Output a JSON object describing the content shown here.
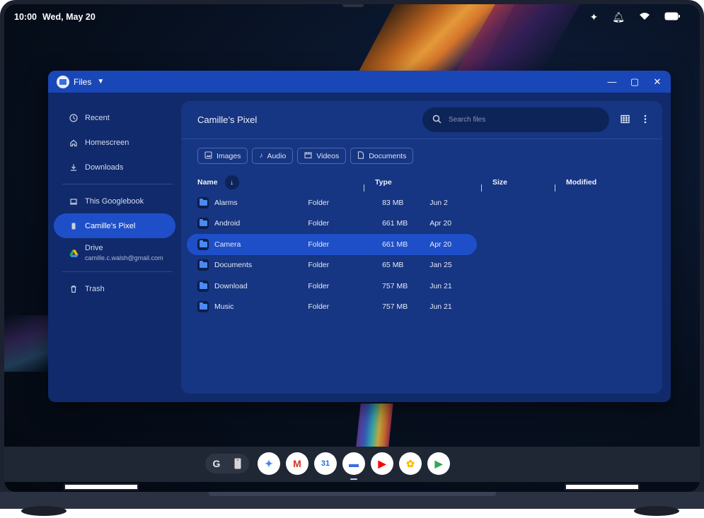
{
  "status": {
    "time": "10:00",
    "date": "Wed, May 20"
  },
  "window": {
    "title": "Files"
  },
  "sidebar": {
    "items": [
      {
        "label": "Recent",
        "icon": "clock-icon"
      },
      {
        "label": "Homescreen",
        "icon": "home-icon"
      },
      {
        "label": "Downloads",
        "icon": "download-icon"
      },
      {
        "label": "This Googlebook",
        "icon": "laptop-icon"
      },
      {
        "label": "Camille’s Pixel",
        "icon": "phone-icon",
        "active": true
      },
      {
        "label": "Trash",
        "icon": "trash-icon"
      }
    ],
    "drive": {
      "label": "Drive",
      "account": "camille.c.walsh@gmail.com"
    }
  },
  "main": {
    "title": "Camille’s Pixel",
    "search_placeholder": "Search files",
    "chips": [
      "Images",
      "Audio",
      "Videos",
      "Documents"
    ],
    "columns": {
      "name": "Name",
      "type": "Type",
      "size": "Size",
      "modified": "Modified"
    },
    "rows": [
      {
        "name": "Alarms",
        "type": "Folder",
        "size": "83 MB",
        "modified": "Jun 2"
      },
      {
        "name": "Android",
        "type": "Folder",
        "size": "661 MB",
        "modified": "Apr 20"
      },
      {
        "name": "Camera",
        "type": "Folder",
        "size": "661 MB",
        "modified": "Apr 20",
        "selected": true
      },
      {
        "name": "Documents",
        "type": "Folder",
        "size": "65 MB",
        "modified": "Jan 25"
      },
      {
        "name": "Download",
        "type": "Folder",
        "size": "757 MB",
        "modified": "Jun 21"
      },
      {
        "name": "Music",
        "type": "Folder",
        "size": "757 MB",
        "modified": "Jun 21"
      }
    ]
  },
  "shelf": {
    "pill": [
      "G"
    ],
    "apps": [
      {
        "name": "gemini-app",
        "glyph": "✦",
        "color": "#4285f4"
      },
      {
        "name": "gmail-app",
        "glyph": "M",
        "color": "#d93025"
      },
      {
        "name": "calendar-app",
        "glyph": "31",
        "color": "#1a73e8"
      },
      {
        "name": "files-app",
        "glyph": "▬",
        "color": "#3b6fe0",
        "active": true
      },
      {
        "name": "youtube-app",
        "glyph": "▶",
        "color": "#ff0000"
      },
      {
        "name": "photos-app",
        "glyph": "✿",
        "color": "#fbbc04"
      },
      {
        "name": "play-store-app",
        "glyph": "▶",
        "color": "#34a853"
      }
    ]
  },
  "colors": {
    "accent": "#1f4fc8",
    "titlebar": "#1a47b8",
    "panel": "#163582",
    "window": "#102a6c"
  }
}
